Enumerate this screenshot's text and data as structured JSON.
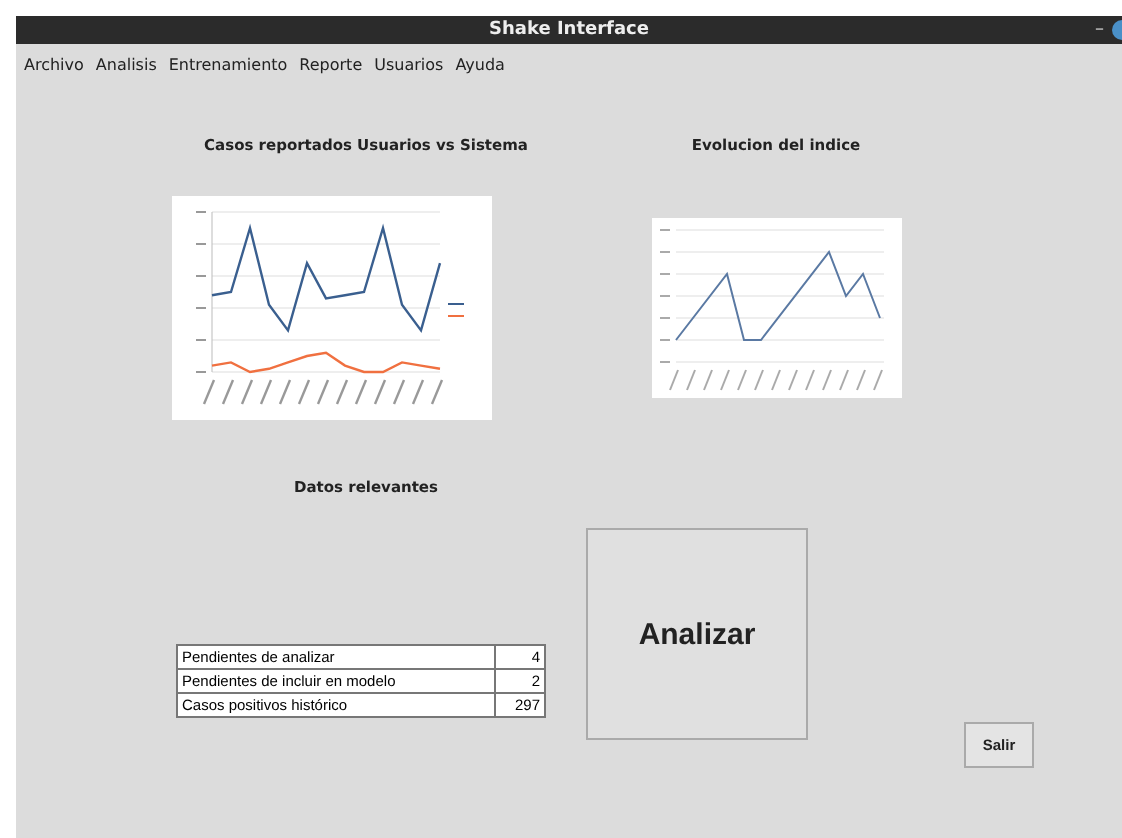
{
  "window": {
    "title": "Shake Interface",
    "minimize": "–"
  },
  "menu": [
    "Archivo",
    "Analisis",
    "Entrenamiento",
    "Reporte",
    "Usuarios",
    "Ayuda"
  ],
  "charts": [
    {
      "title": "Casos reportados Usuarios vs Sistema",
      "kind": "dual"
    },
    {
      "title": "Evolucion del indice",
      "kind": "single"
    }
  ],
  "data_title": "Datos relevantes",
  "table": [
    {
      "label": "Pendientes de analizar",
      "value": "4"
    },
    {
      "label": "Pendientes de incluir en modelo",
      "value": "2"
    },
    {
      "label": "Casos positivos histórico",
      "value": "297"
    }
  ],
  "analyze_button": "Analizar",
  "exit_button": "Salir"
}
